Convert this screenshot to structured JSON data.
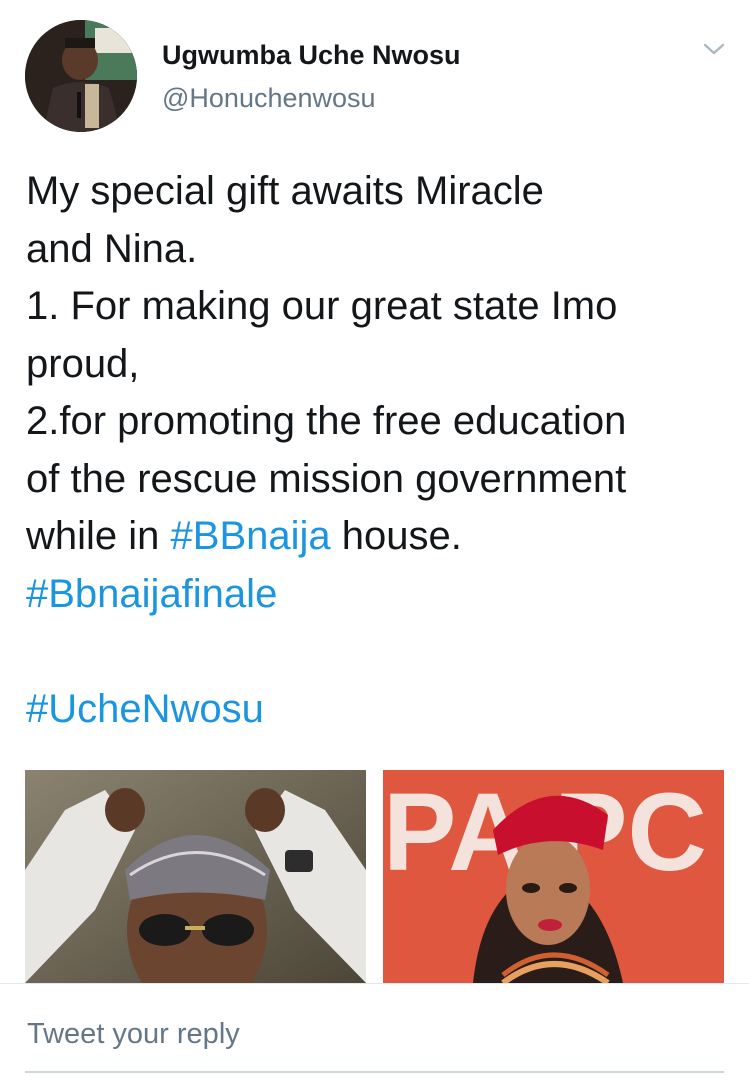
{
  "tweet": {
    "author": {
      "display_name": "Ugwumba Uche Nwosu",
      "handle": "@Honuchenwosu"
    },
    "lines": [
      [
        {
          "text": "My special  gift awaits Miracle",
          "hashtag": false
        }
      ],
      [
        {
          "text": "and Nina.",
          "hashtag": false
        }
      ],
      [
        {
          "text": "1. For making  our great state Imo",
          "hashtag": false
        }
      ],
      [
        {
          "text": "proud,",
          "hashtag": false
        }
      ],
      [
        {
          "text": "2.for promoting the free education",
          "hashtag": false
        }
      ],
      [
        {
          "text": "of the rescue mission government",
          "hashtag": false
        }
      ],
      [
        {
          "text": "while in ",
          "hashtag": false
        },
        {
          "text": "#BBnaija",
          "hashtag": true
        },
        {
          "text": " house.",
          "hashtag": false
        }
      ],
      [
        {
          "text": "#Bbnaijafinale",
          "hashtag": true
        }
      ],
      [
        {
          "text": "",
          "hashtag": false
        }
      ],
      [
        {
          "text": "#UcheNwosu",
          "hashtag": true
        }
      ]
    ],
    "media": [
      {
        "name": "media-photo-man-cap"
      },
      {
        "name": "media-photo-woman-red-cap"
      }
    ],
    "media_poster_text": "PA PC"
  },
  "reply": {
    "placeholder": "Tweet your reply"
  },
  "icons": {
    "menu": "chevron-down-icon"
  },
  "colors": {
    "text": "#14171a",
    "secondary": "#657786",
    "link": "#1b95e0",
    "divider": "#e1e8ed"
  }
}
